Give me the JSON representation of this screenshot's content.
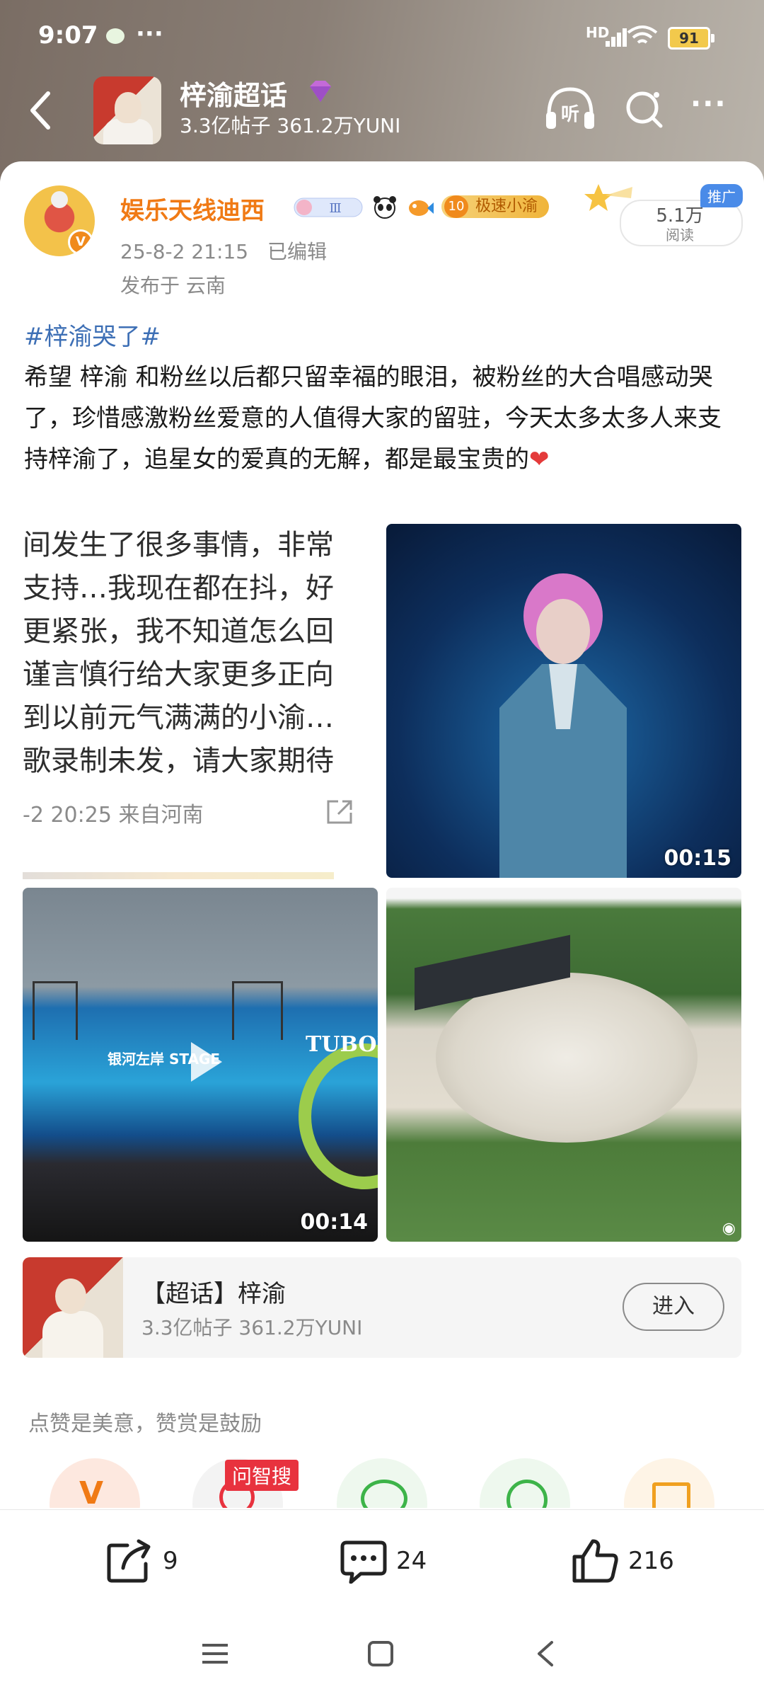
{
  "status_bar": {
    "time": "9:07",
    "dots": "···",
    "network": "HD",
    "battery": "91"
  },
  "topic_header": {
    "title": "梓渝超话",
    "stats": "3.3亿帖子 361.2万YUNI",
    "listen_label": "听"
  },
  "post": {
    "author": "娱乐天线迪西",
    "level_num": "10",
    "level_label": "极速小渝",
    "fan_badge": "Ⅲ",
    "date": "25-8-2 21:15",
    "edited": "已编辑",
    "location": "发布于 云南",
    "promo": {
      "views": "5.1万",
      "views_label": "阅读",
      "tag": "推广"
    },
    "hashtag": "#梓渝哭了#",
    "body": "希望 梓渝 和粉丝以后都只留幸福的眼泪，被粉丝的大合唱感动哭了，珍惜感激粉丝爱意的人值得大家的留驻，今天太多太多人来支持梓渝了，追星女的爱真的无解，都是最宝贵的",
    "screenshot_lines": [
      "间发生了很多事情，非常",
      "支持…我现在都在抖，好",
      "更紧张，我不知道怎么回",
      "谨言慎行给大家更多正向",
      "到以前元气满满的小渝…",
      "歌录制未发，请大家期待"
    ],
    "screenshot_footer": "-2 20:25  来自河南",
    "video1_duration": "00:15",
    "video2_duration": "00:14",
    "video2_brand": "TUBOR",
    "video2_stage_text": "银河左岸 STAGE"
  },
  "topic_card": {
    "title": "【超话】梓渝",
    "stats": "3.3亿帖子 361.2万YUNI",
    "enter": "进入"
  },
  "reward": {
    "text": "点赞是美意，赞赏是鼓励",
    "wenzhisou": "问智搜"
  },
  "actions": {
    "repost_count": "9",
    "comment_count": "24",
    "like_count": "216"
  },
  "colors": {
    "username": "#f07a15",
    "hashtag": "#3d6fb5",
    "wenzhisou_badge": "#e8323e"
  }
}
